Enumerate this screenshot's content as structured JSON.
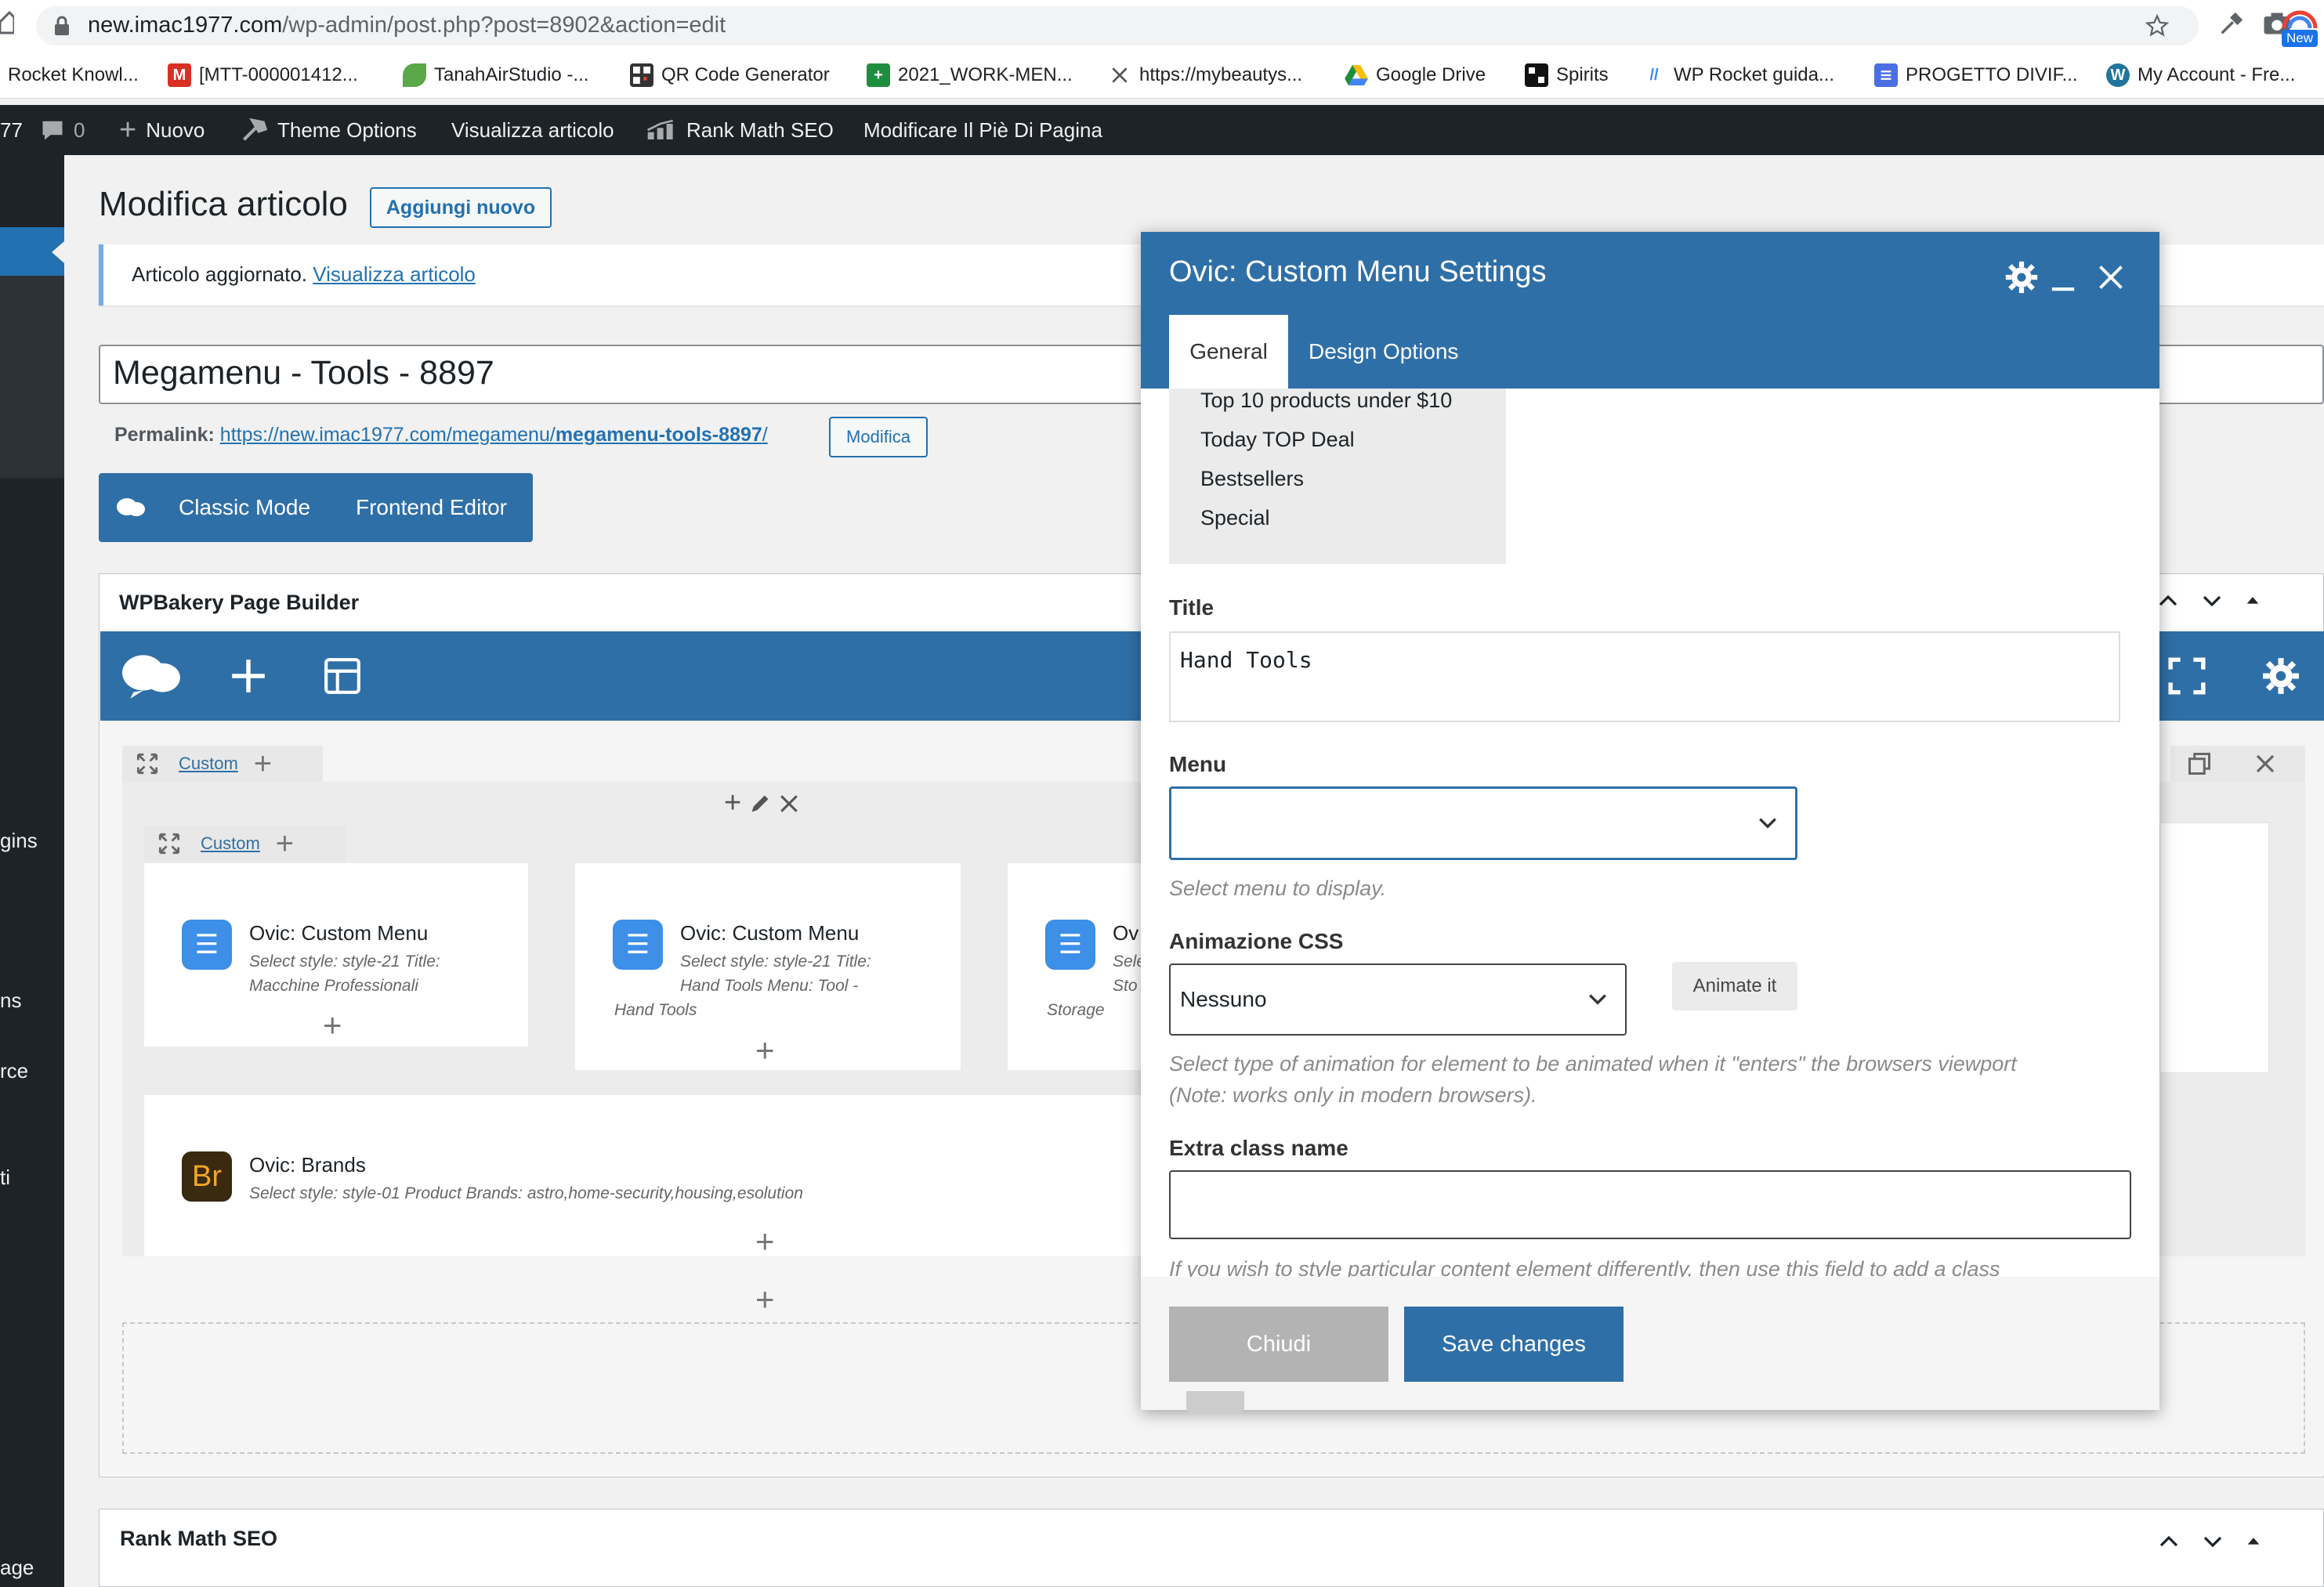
{
  "browser": {
    "url_host": "new.imac1977.com",
    "url_path": "/wp-admin/post.php?post=8902&action=edit",
    "new_badge": "New",
    "bookmarks": [
      {
        "label": "Rocket Knowl...",
        "color": "#f06a35"
      },
      {
        "label": "[MTT-000001412...",
        "color": "#d93025",
        "glyph": "M"
      },
      {
        "label": "TanahAirStudio -...",
        "color": "#5ba84a"
      },
      {
        "label": "QR Code Generator",
        "color": "#333333"
      },
      {
        "label": "2021_WORK-MEN...",
        "color": "#1e8e3e",
        "glyph": "+"
      },
      {
        "label": "https://mybeautys...",
        "color": "#555555"
      },
      {
        "label": "Google Drive",
        "color": "#fbbc04"
      },
      {
        "label": "Spirits",
        "color": "#111111"
      },
      {
        "label": "WP Rocket guida...",
        "color": "#4285f4"
      },
      {
        "label": "PROGETTO DIVIF...",
        "color": "#4a6fe3"
      },
      {
        "label": "My Account - Fre...",
        "color": "#21759b"
      }
    ]
  },
  "adminbar": {
    "site_fragment": "77",
    "comments": "0",
    "new": "Nuovo",
    "theme_options": "Theme Options",
    "view_post": "Visualizza articolo",
    "rank_math": "Rank Math SEO",
    "footer": "Modificare Il Piè Di Pagina"
  },
  "sidemenu": {
    "fragments": [
      "gins",
      "ns",
      "rce",
      "ti",
      "age"
    ]
  },
  "page": {
    "title": "Modifica articolo",
    "add_new": "Aggiungi nuovo",
    "notice_text": "Articolo aggiornato.",
    "notice_link": "Visualizza articolo",
    "post_title": "Megamenu - Tools - 8897",
    "permalink_label": "Permalink:",
    "permalink_base": "https://new.imac1977.com/megamenu/",
    "permalink_slug": "megamenu-tools-8897",
    "permalink_trail": "/",
    "permalink_edit": "Modifica",
    "classic_mode": "Classic Mode",
    "frontend_editor": "Frontend Editor"
  },
  "wpbakery": {
    "title": "WPBakery Page Builder",
    "row_label": "Custom",
    "inner_row_label": "Custom",
    "elements": [
      {
        "name": "Ovic: Custom Menu",
        "desc1": "Select style: style-21 Title:",
        "desc2": "Macchine Professionali",
        "desc3": ""
      },
      {
        "name": "Ovic: Custom Menu",
        "desc1": "Select style: style-21 Title:",
        "desc2": "Hand Tools Menu: Tool -",
        "desc3": "Hand Tools"
      },
      {
        "name": "Ov",
        "desc1": "Sele",
        "desc2": "Sto",
        "desc3": "Storage"
      }
    ],
    "brands": {
      "name": "Ovic: Brands",
      "desc": "Select style: style-01 Product Brands: astro,home-security,housing,esolution",
      "icon_text": "Br"
    }
  },
  "modal": {
    "title": "Ovic: Custom Menu Settings",
    "tabs": [
      "General",
      "Design Options"
    ],
    "menu_list": [
      "Top 10 products under $10",
      "Today TOP Deal",
      "Bestsellers",
      "Special"
    ],
    "title_label": "Title",
    "title_value": "Hand Tools",
    "menu_label": "Menu",
    "menu_value": "",
    "menu_desc": "Select menu to display.",
    "anim_label": "Animazione CSS",
    "anim_value": "Nessuno",
    "animate_button": "Animate it",
    "anim_desc1": "Select type of animation for element to be animated when it \"enters\" the browsers viewport",
    "anim_desc2": "(Note: works only in modern browsers).",
    "extra_label": "Extra class name",
    "extra_value": "",
    "extra_desc": "If you wish to style particular content element differently, then use this field to add a class",
    "close": "Chiudi",
    "save": "Save changes"
  },
  "rankmath": {
    "title": "Rank Math SEO"
  }
}
